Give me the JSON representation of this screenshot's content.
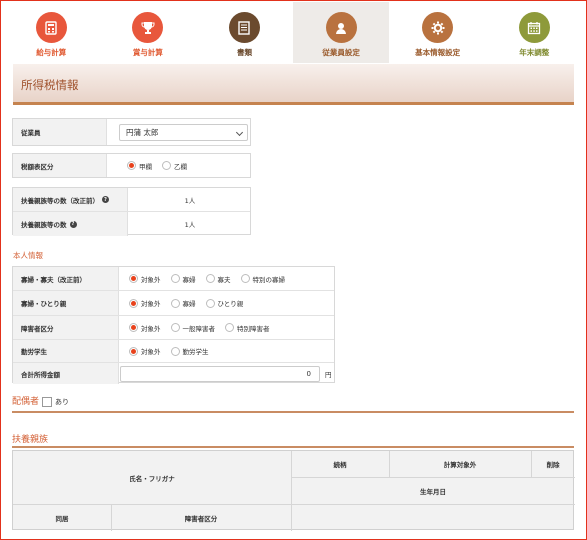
{
  "nav": {
    "items": [
      {
        "label": "給与計算",
        "color": "#e8573c",
        "icon": "calculator-icon",
        "active": false
      },
      {
        "label": "賞与計算",
        "color": "#e8573c",
        "icon": "trophy-icon",
        "active": false
      },
      {
        "label": "書類",
        "color": "#6b4a2e",
        "icon": "document-icon",
        "active": false
      },
      {
        "label": "従業員設定",
        "color": "#b9723f",
        "icon": "person-icon",
        "active": true
      },
      {
        "label": "基本情報設定",
        "color": "#b9723f",
        "icon": "gear-icon",
        "active": false
      },
      {
        "label": "年末調整",
        "color": "#8e9a3a",
        "icon": "calendar-icon",
        "active": false
      }
    ]
  },
  "page": {
    "title": "所得税情報"
  },
  "employee": {
    "label": "従業員",
    "selected": "円蒲 太郎"
  },
  "tax_table": {
    "label": "税額表区分",
    "options": [
      "甲欄",
      "乙欄"
    ],
    "selected_index": 0
  },
  "dependents": {
    "revised_label": "扶養親族等の数（改正前）",
    "revised_value": "1人",
    "count_label": "扶養親族等の数",
    "count_value": "1人"
  },
  "personal": {
    "heading": "本人情報",
    "rows": [
      {
        "label": "寡婦・寡夫（改正前）",
        "options": [
          "対象外",
          "寡婦",
          "寡夫",
          "特別の寡婦"
        ],
        "selected_index": 0
      },
      {
        "label": "寡婦・ひとり親",
        "options": [
          "対象外",
          "寡婦",
          "ひとり親"
        ],
        "selected_index": 0
      },
      {
        "label": "障害者区分",
        "options": [
          "対象外",
          "一般障害者",
          "特別障害者"
        ],
        "selected_index": 0
      },
      {
        "label": "勤労学生",
        "options": [
          "対象外",
          "勤労学生"
        ],
        "selected_index": 0
      }
    ],
    "income_label": "合計所得金額",
    "income_value": "0",
    "income_unit": "円"
  },
  "spouse": {
    "heading": "配偶者",
    "checkbox_label": "あり"
  },
  "dependent_family": {
    "heading": "扶養親族",
    "columns": {
      "name": "氏名・フリガナ",
      "relation": "続柄",
      "calc_target": "計算対象外",
      "delete": "削除",
      "birthdate": "生年月日",
      "cohabit": "同居",
      "disability": "障害者区分"
    }
  }
}
